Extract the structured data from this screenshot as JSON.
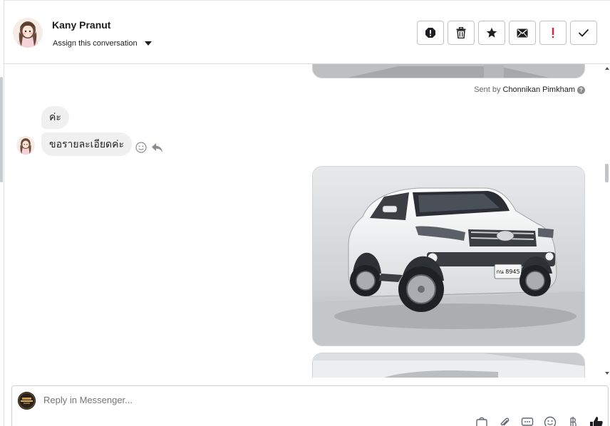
{
  "header": {
    "contact_name": "Kany Pranut",
    "assign_label": "Assign this conversation",
    "actions": [
      {
        "name": "spam-icon"
      },
      {
        "name": "trash-icon"
      },
      {
        "name": "star-icon"
      },
      {
        "name": "envelope-icon"
      },
      {
        "name": "exclamation-icon"
      },
      {
        "name": "checkmark-icon"
      }
    ]
  },
  "thread": {
    "sent_by_prefix": "Sent by",
    "sent_by_name": "Chonnikan Pimkham",
    "help_mark": "?",
    "messages": [
      {
        "text": "ค่ะ"
      },
      {
        "text": "ขอรายละเอียดค่ะ"
      }
    ],
    "car_plate": "กน 8945"
  },
  "composer": {
    "placeholder": "Reply in Messenger...",
    "tools": [
      "bag-icon",
      "paperclip-icon",
      "saved-reply-icon",
      "emoji-icon",
      "baht-icon",
      "thumbs-up-icon"
    ]
  },
  "colors": {
    "accent": "#1c1e21",
    "warning": "#e41e3f",
    "border": "#bec3c9",
    "bubble": "#f0f0f0"
  }
}
